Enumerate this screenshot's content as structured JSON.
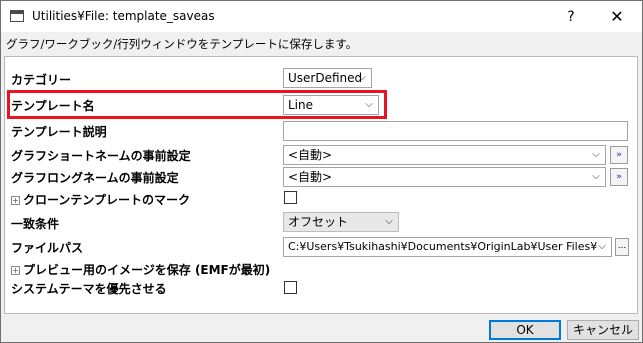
{
  "window": {
    "title": "Utilities¥File: template_saveas",
    "help_label": "?",
    "close_label": "✕"
  },
  "description": "グラフ/ワークブック/行列ウィンドウをテンプレートに保存します。",
  "form": {
    "category": {
      "label": "カテゴリー",
      "value": "UserDefined"
    },
    "template_name": {
      "label": "テンプレート名",
      "value": "Line"
    },
    "template_description": {
      "label": "テンプレート説明",
      "value": ""
    },
    "graph_short_name": {
      "label": "グラフショートネームの事前設定",
      "value": "<自動>",
      "button": "»"
    },
    "graph_long_name": {
      "label": "グラフロングネームの事前設定",
      "value": "<自動>",
      "button": "»"
    },
    "clone_template_mark": {
      "label": "クローンテンプレートのマーク",
      "expander": "+",
      "checked": false
    },
    "match_condition": {
      "label": "一致条件",
      "value": "オフセット"
    },
    "file_path": {
      "label": "ファイルパス",
      "value": "C:¥Users¥Tsukihashi¥Documents¥OriginLab¥User Files¥",
      "button": "..."
    },
    "preview_image": {
      "label": "プレビュー用のイメージを保存 (EMFが最初)",
      "expander": "+"
    },
    "prefer_system_theme": {
      "label": "システムテーマを優先させる",
      "checked": false
    }
  },
  "buttons": {
    "ok": "OK",
    "cancel": "キャンセル"
  },
  "colors": {
    "highlight": "#e8141f",
    "default_button_border": "#0078d7"
  }
}
